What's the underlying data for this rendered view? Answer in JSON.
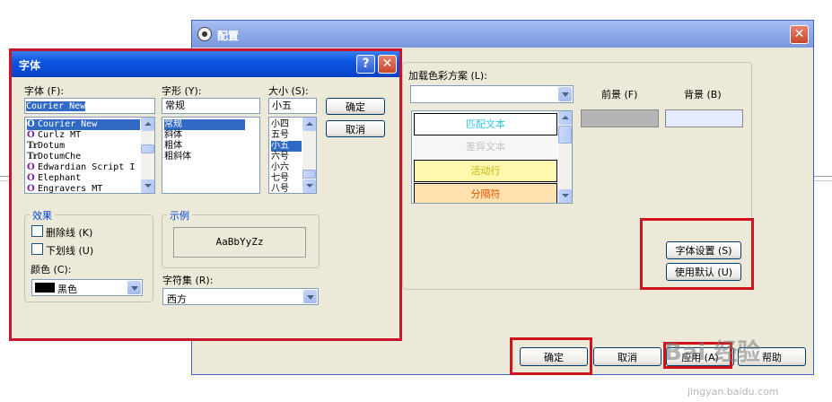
{
  "config": {
    "title": "配置",
    "scheme_label": "加载色彩方案 (L):",
    "scheme_value": "",
    "fg_label": "前景 (F)",
    "bg_label": "背景 (B)",
    "fg_color": "#b4b4b4",
    "bg_color": "#e4ecfb",
    "scheme_items": [
      {
        "text": "匹配文本",
        "color": "#2ec5e0",
        "bg": "#ffffff"
      },
      {
        "text": "差异文本",
        "color": "#c3c3c3",
        "bg": "#f6f6f6"
      },
      {
        "text": "活动行",
        "color": "#c8b400",
        "bg": "#fff9b0"
      },
      {
        "text": "分隔符",
        "color": "#e05000",
        "bg": "#ffe2b0"
      }
    ],
    "font_settings_button": "字体设置 (S)",
    "use_default_button": "使用默认 (U)",
    "ok_button": "确定",
    "cancel_button": "取消",
    "apply_button": "应用 (A)",
    "help_button": "帮助"
  },
  "font_dialog": {
    "title": "字体",
    "help_icon": "?",
    "close_icon": "✕",
    "font_label": "字体 (F):",
    "font_value": "Courier New",
    "fonts": [
      {
        "name": "Courier New",
        "icon": "O",
        "selected": true
      },
      {
        "name": "Curlz MT",
        "icon": "O",
        "selected": false
      },
      {
        "name": "Dotum",
        "icon": "Tr",
        "selected": false
      },
      {
        "name": "DotumChe",
        "icon": "Tr",
        "selected": false
      },
      {
        "name": "Edwardian Script I",
        "icon": "O",
        "selected": false
      },
      {
        "name": "Elephant",
        "icon": "O",
        "selected": false
      },
      {
        "name": "Engravers MT",
        "icon": "O",
        "selected": false
      }
    ],
    "style_label": "字形 (Y):",
    "style_value": "常规",
    "styles": [
      {
        "name": "常规",
        "selected": true
      },
      {
        "name": "斜体",
        "selected": false
      },
      {
        "name": "粗体",
        "selected": false
      },
      {
        "name": "粗斜体",
        "selected": false
      }
    ],
    "size_label": "大小 (S):",
    "size_value": "小五",
    "sizes": [
      {
        "name": "小四",
        "selected": false
      },
      {
        "name": "五号",
        "selected": false
      },
      {
        "name": "小五",
        "selected": true
      },
      {
        "name": "六号",
        "selected": false
      },
      {
        "name": "小六",
        "selected": false
      },
      {
        "name": "七号",
        "selected": false
      },
      {
        "name": "八号",
        "selected": false
      }
    ],
    "ok_button": "确定",
    "cancel_button": "取消",
    "effects_label": "效果",
    "strikeout_label": "删除线 (K)",
    "underline_label": "下划线 (U)",
    "color_label": "颜色 (C):",
    "color_value": "黑色",
    "color_swatch": "#000000",
    "sample_label": "示例",
    "sample_text": "AaBbYyZz",
    "charset_label": "字符集 (R):",
    "charset_value": "西方"
  },
  "watermark": {
    "brand": "Bai 经验",
    "url": "jingyan.baidu.com"
  }
}
